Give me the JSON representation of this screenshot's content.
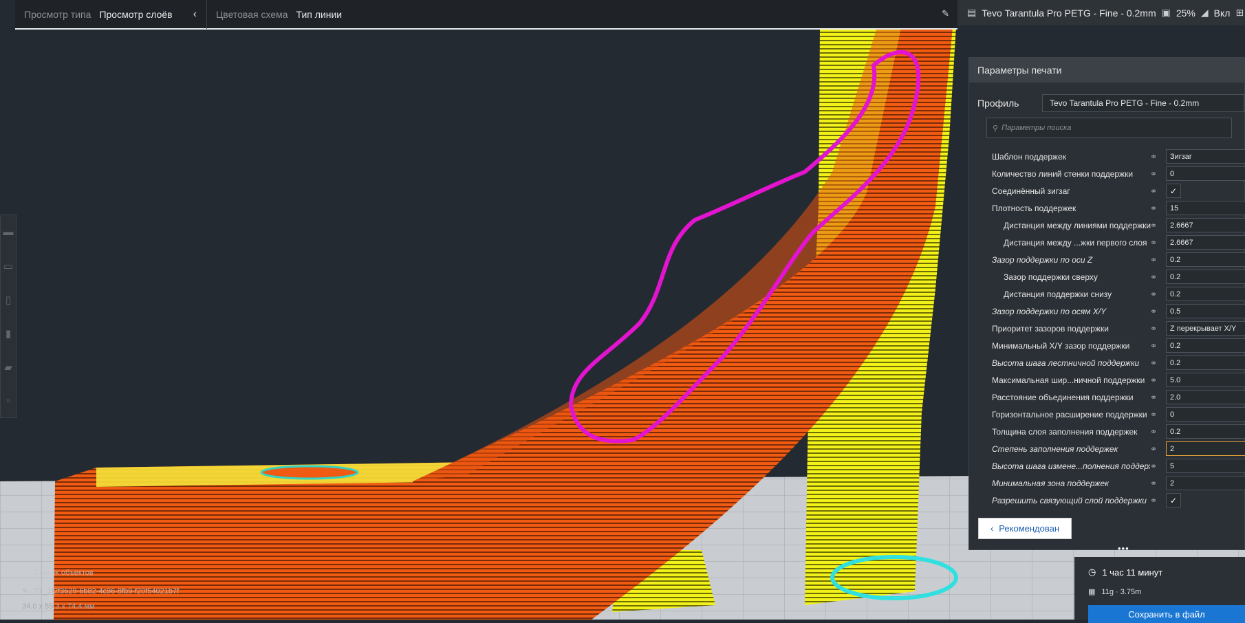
{
  "topbar": {
    "view_type_label": "Просмотр типа",
    "view_type_value": "Просмотр слоёв",
    "color_scheme_label": "Цветовая схема",
    "color_scheme_value": "Тип линии"
  },
  "printer_bar": {
    "printer_name": "Tevo Tarantula Pro PETG - Fine - 0.2mm",
    "infill": "25%",
    "support": "Вкл"
  },
  "panel": {
    "title": "Параметры печати",
    "profile_label": "Профиль",
    "profile_value": "Tevo Tarantula Pro PETG - Fine - 0.2mm",
    "search_placeholder": "Параметры поиска",
    "settings": [
      {
        "name": "Шаблон поддержек",
        "value": "Зигзаг",
        "type": "select"
      },
      {
        "name": "Количество линий стенки поддержки",
        "value": "0",
        "type": "text"
      },
      {
        "name": "Соединённый зигзаг",
        "value": "✓",
        "type": "check"
      },
      {
        "name": "Плотность поддержек",
        "value": "15",
        "type": "text"
      },
      {
        "name": "Дистанция между линиями поддержки",
        "value": "2.6667",
        "type": "text"
      },
      {
        "name": "Дистанция между ...жки первого слоя",
        "value": "2.6667",
        "type": "text"
      },
      {
        "name": "Зазор поддержки по оси Z",
        "value": "0.2",
        "type": "text"
      },
      {
        "name": "Зазор поддержки сверху",
        "value": "0.2",
        "type": "text"
      },
      {
        "name": "Дистанция поддержки снизу",
        "value": "0.2",
        "type": "text"
      },
      {
        "name": "Зазор поддержки по осям X/Y",
        "value": "0.5",
        "type": "text"
      },
      {
        "name": "Приоритет зазоров поддержки",
        "value": "Z перекрывает X/Y",
        "type": "select"
      },
      {
        "name": "Минимальный X/Y зазор поддержки",
        "value": "0.2",
        "type": "text"
      },
      {
        "name": "Высота шага лестничной поддержки",
        "value": "0.2",
        "type": "text"
      },
      {
        "name": "Максимальная шир...ничной поддержки",
        "value": "5.0",
        "type": "text"
      },
      {
        "name": "Расстояние объединения поддержки",
        "value": "2.0",
        "type": "text"
      },
      {
        "name": "Горизонтальное расширение поддержки",
        "value": "0",
        "type": "text"
      },
      {
        "name": "Толщина слоя заполнения поддержек",
        "value": "0.2",
        "type": "text"
      },
      {
        "name": "Степень заполнения поддержек",
        "value": "2",
        "type": "text"
      },
      {
        "name": "Высота шага измене...полнения поддержек",
        "value": "5",
        "type": "text"
      },
      {
        "name": "Минимальная зона поддержек",
        "value": "2",
        "type": "text"
      },
      {
        "name": "Разрешить связующий слой поддержки",
        "value": "✓",
        "type": "check"
      }
    ],
    "recommended_label": "Рекомендован"
  },
  "print_info": {
    "time": "1 час 11 минут",
    "material": "11g · 3.75m",
    "save_label": "Сохранить в файл"
  },
  "object_list": {
    "header": "Список объектов",
    "file": "TT_1f2f3629-6b82-4c96-8fb9-f20f54021b7f",
    "dimensions": "34.0 x 55.3 x 74.4 мм"
  },
  "icons": [
    "chevron-left-icon",
    "pencil-icon",
    "printer-icon",
    "infill-icon",
    "support-icon",
    "link-icon",
    "search-icon",
    "check-icon",
    "clock-icon",
    "spool-icon",
    "pencil-icon"
  ]
}
